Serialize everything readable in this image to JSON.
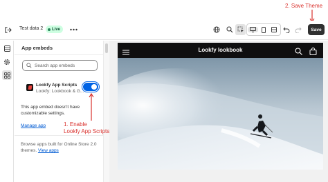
{
  "annotations": {
    "save_theme": "2. Save Theme",
    "enable_line1": "1. Enable",
    "enable_line2": "Lookfy App Scripts"
  },
  "topbar": {
    "theme_name": "Test data 2",
    "live_badge": "Live",
    "save_label": "Save",
    "icons": [
      "exit-icon",
      "more-icon",
      "globe-icon",
      "zoom-icon",
      "inspector-icon",
      "desktop-icon",
      "mobile-icon",
      "fullscreen-icon",
      "undo-icon",
      "redo-icon"
    ]
  },
  "rail": {
    "items": [
      "sections-icon",
      "settings-icon",
      "app-embeds-icon"
    ],
    "active": "app-embeds-icon"
  },
  "panel": {
    "title": "App embeds",
    "search_placeholder": "Search app embeds",
    "app": {
      "name": "Lookfy App Scripts",
      "subtitle": "Lookfy: Lookbook & G...",
      "enabled": true
    },
    "note": "This app embed doesn't have customizable settings.",
    "manage_link": "Manage app",
    "browse_text": "Browse apps built for Online Store 2.0 themes.",
    "view_apps_link": "View apps"
  },
  "preview": {
    "store_title": "Lookfy lookbook",
    "icons": [
      "menu-icon",
      "search-icon",
      "cart-icon"
    ]
  },
  "colors": {
    "accent": "#0063e5",
    "annotation": "#d9302c",
    "store_header": "#0f0f10",
    "save_button": "#303030"
  }
}
